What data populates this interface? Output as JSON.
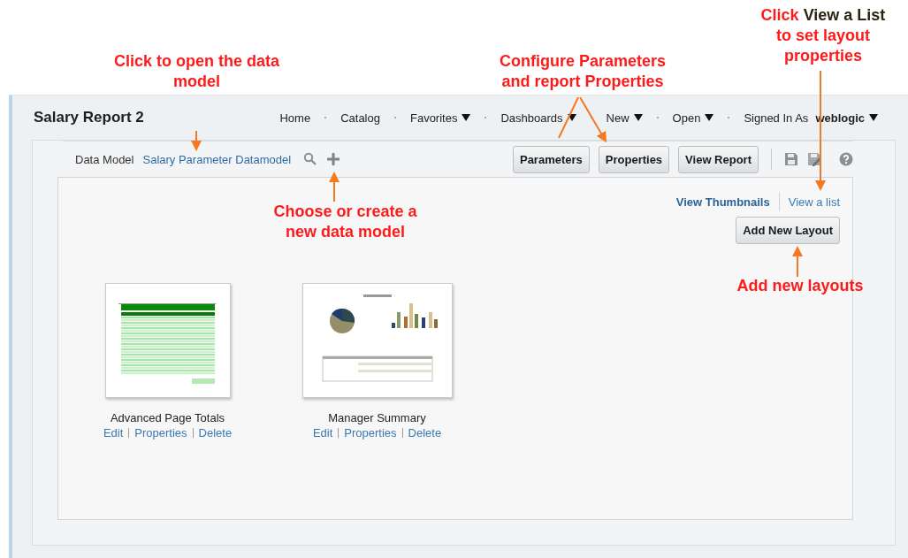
{
  "window": {
    "title": "Salary Report 2"
  },
  "nav": [
    {
      "label": "Home",
      "menu": false
    },
    {
      "label": "Catalog",
      "menu": false
    },
    {
      "label": "Favorites",
      "menu": true
    },
    {
      "label": "Dashboards",
      "menu": true
    },
    {
      "label": "New",
      "menu": true
    },
    {
      "label": "Open",
      "menu": true
    }
  ],
  "user": {
    "prefix": "Signed In As",
    "name": "weblogic"
  },
  "data_model": {
    "label": "Data Model",
    "name": "Salary Parameter Datamodel"
  },
  "toolbar_buttons": [
    "Parameters",
    "Properties",
    "View Report"
  ],
  "view_options": [
    {
      "label": "View Thumbnails",
      "selected": true
    },
    {
      "label": "View a list",
      "selected": false
    }
  ],
  "add_layout_button": "Add New Layout",
  "layouts": [
    {
      "name": "Advanced Page Totals",
      "kind": "table",
      "actions": [
        "Edit",
        "Properties",
        "Delete"
      ]
    },
    {
      "name": "Manager Summary",
      "kind": "chart",
      "actions": [
        "Edit",
        "Properties",
        "Delete"
      ]
    }
  ],
  "callouts": [
    {
      "segments": [
        {
          "text": "Click to open the data model",
          "highlight": false
        }
      ]
    },
    {
      "segments": [
        {
          "text": "Configure Parameters and report Properties",
          "highlight": false
        }
      ]
    },
    {
      "segments": [
        {
          "text": "Click",
          "highlight": false
        },
        {
          "text": "View a List",
          "highlight": true
        },
        {
          "text": "to set layout properties",
          "highlight": false
        }
      ]
    },
    {
      "segments": [
        {
          "text": "Choose or create a new data model",
          "highlight": false
        }
      ]
    },
    {
      "segments": [
        {
          "text": "Add new layouts",
          "highlight": false
        }
      ]
    }
  ]
}
